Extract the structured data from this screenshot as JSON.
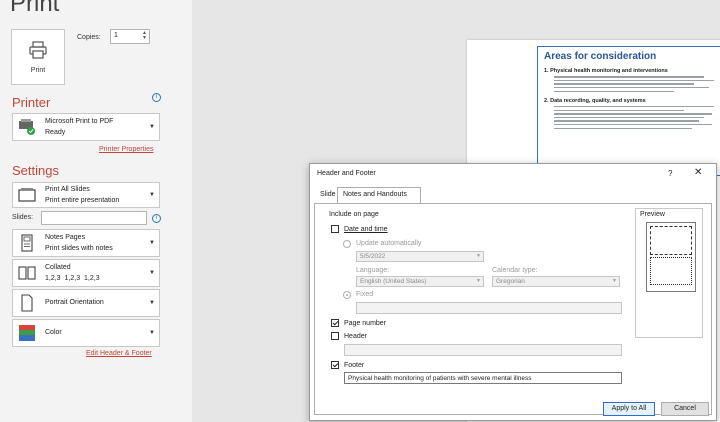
{
  "page": {
    "title": "Print"
  },
  "print_button": {
    "label": "Print",
    "icon": "printer-icon"
  },
  "copies": {
    "label": "Copies:",
    "value": "1"
  },
  "printer": {
    "section_title": "Printer",
    "name": "Microsoft Print to PDF",
    "status": "Ready",
    "properties_link": "Printer Properties"
  },
  "settings": {
    "section_title": "Settings",
    "print_what": {
      "line1": "Print All Slides",
      "line2": "Print entire presentation"
    },
    "slides_label": "Slides:",
    "slides_value": "",
    "layout": {
      "line1": "Notes Pages",
      "line2": "Print slides with notes"
    },
    "collation": {
      "line1": "Collated",
      "line2": "1,2,3   1,2,3   1,2,3"
    },
    "orientation": {
      "line1": "Portrait Orientation"
    },
    "color": {
      "line1": "Color"
    },
    "edit_link": "Edit Header & Footer"
  },
  "preview_slide": {
    "title": "Areas for consideration",
    "item1": "1.   Physical health monitoring and interventions",
    "item2": "2.   Data recording, quality, and systems"
  },
  "dialog": {
    "title": "Header and Footer",
    "help": "?",
    "close": "✕",
    "tabs": [
      "Slide",
      "Notes and Handouts"
    ],
    "active_tab": 1,
    "include_label": "Include on page",
    "date_time": {
      "label": "Date and time",
      "checked": false
    },
    "update_auto": {
      "label": "Update automatically",
      "date": "5/5/2022"
    },
    "language": {
      "label": "Language:",
      "value": "English (United States)"
    },
    "calendar": {
      "label": "Calendar type:",
      "value": "Gregorian"
    },
    "fixed": {
      "label": "Fixed",
      "value": ""
    },
    "page_number": {
      "label": "Page number",
      "checked": true
    },
    "header": {
      "label": "Header",
      "checked": false,
      "value": ""
    },
    "footer": {
      "label": "Footer",
      "checked": true,
      "value": "Physical health monitoring of patients with severe mental illness"
    },
    "preview_label": "Preview",
    "apply_all": "Apply to All",
    "cancel": "Cancel"
  },
  "colors": {
    "accent": "#c1473b",
    "link_blue": "#2b74c7",
    "button_border": "#2f6ccf"
  }
}
